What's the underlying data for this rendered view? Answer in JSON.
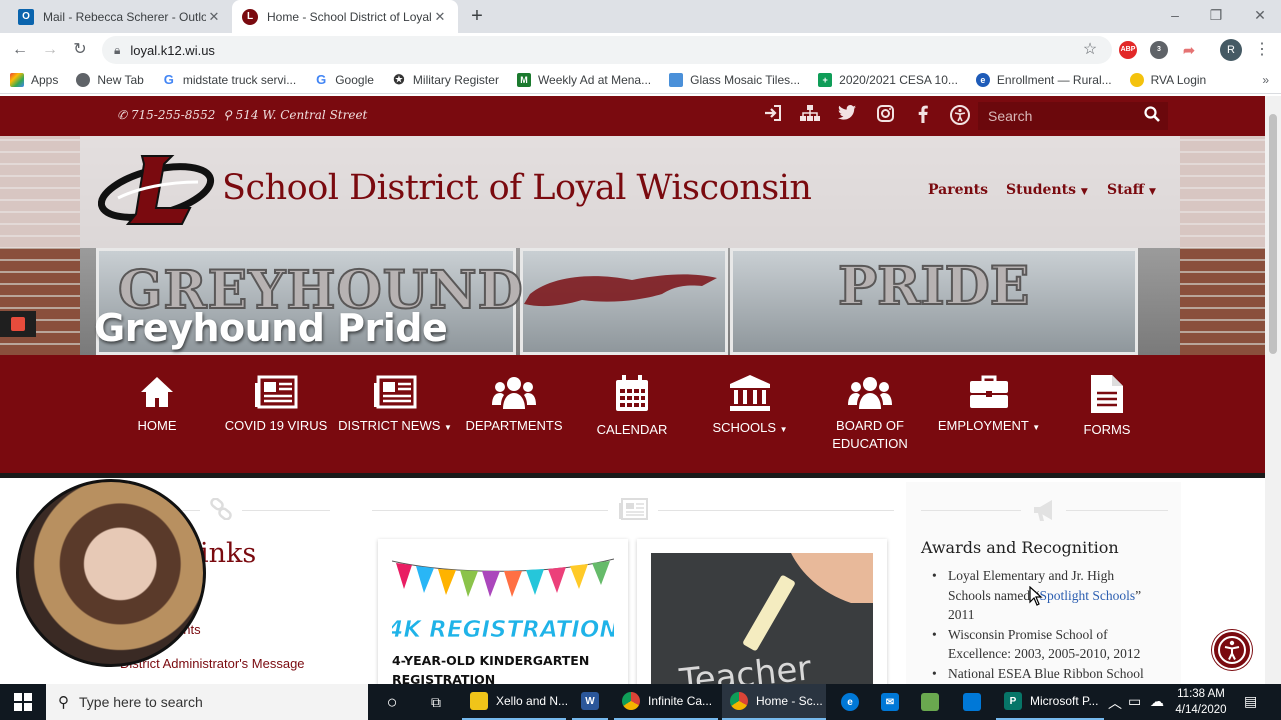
{
  "browser": {
    "tabs": [
      {
        "title": "Mail - Rebecca Scherer - Outlook",
        "active": false
      },
      {
        "title": "Home - School District of Loyal W",
        "active": true
      }
    ],
    "url": "loyal.k12.wi.us",
    "profile_initial": "R",
    "extensions": [
      "ABP",
      "3"
    ],
    "bookmarks": [
      {
        "label": "Apps",
        "icon": "apps-grid-icon",
        "color": "#ea4335"
      },
      {
        "label": "New Tab",
        "icon": "globe-icon",
        "color": "#5f6368"
      },
      {
        "label": "midstate truck servi...",
        "icon": "google-icon",
        "color": "#4285f4"
      },
      {
        "label": "Google",
        "icon": "google-icon",
        "color": "#4285f4"
      },
      {
        "label": "Military Register",
        "icon": "star-badge-icon",
        "color": "#333333"
      },
      {
        "label": "Weekly Ad at Mena...",
        "icon": "m-icon",
        "color": "#1b7a2e"
      },
      {
        "label": "Glass Mosaic Tiles...",
        "icon": "tile-icon",
        "color": "#4a90d9"
      },
      {
        "label": "2020/2021 CESA 10...",
        "icon": "plus-sheet-icon",
        "color": "#0f9d58"
      },
      {
        "label": "Enrollment — Rural...",
        "icon": "circle-e-icon",
        "color": "#1e5bb8"
      },
      {
        "label": "RVA Login",
        "icon": "bulb-icon",
        "color": "#f4c20d"
      }
    ]
  },
  "site": {
    "phone": "715-255-8552",
    "address": "514 W. Central Street",
    "search_placeholder": "Search",
    "title": "School District of Loyal Wisconsin",
    "header_nav": [
      "Parents",
      "Students",
      "Staff"
    ],
    "hero_painted_left": "GREYHOUND",
    "hero_painted_right": "PRIDE",
    "hero_caption": "Greyhound Pride",
    "main_nav": [
      {
        "label": "HOME",
        "icon": "home-icon",
        "dropdown": false
      },
      {
        "label": "COVID 19 VIRUS",
        "icon": "newspaper-icon",
        "dropdown": false
      },
      {
        "label": "DISTRICT NEWS",
        "icon": "newspaper-icon",
        "dropdown": true
      },
      {
        "label": "DEPARTMENTS",
        "icon": "users-icon",
        "dropdown": false
      },
      {
        "label": "CALENDAR",
        "icon": "calendar-icon",
        "dropdown": false
      },
      {
        "label": "SCHOOLS",
        "icon": "institution-icon",
        "dropdown": true
      },
      {
        "label": "BOARD OF EDUCATION",
        "icon": "users-icon",
        "dropdown": false
      },
      {
        "label": "EMPLOYMENT",
        "icon": "briefcase-icon",
        "dropdown": true
      },
      {
        "label": "FORMS",
        "icon": "file-icon",
        "dropdown": false
      }
    ],
    "quicklinks_title_visible": "inks",
    "quicklinks": [
      "ents",
      "District Administrator's Message"
    ],
    "cards": [
      {
        "title": "4-YEAR-OLD KINDERGARTEN REGISTRATION",
        "image_text": "4K REGISTRATION"
      },
      {
        "title": "",
        "image_text": "Teacher"
      }
    ],
    "awards_title": "Awards and Recognition",
    "awards": [
      {
        "before": "Loyal Elementary and Jr. High Schools named “",
        "link": "Spotlight Schools",
        "after": "” 2011"
      },
      {
        "before": "Wisconsin Promise School of Excellence: 2003, 2005-2010, 2012",
        "link": "",
        "after": ""
      },
      {
        "before": "National ESEA Blue Ribbon School Award",
        "link": "",
        "after": ""
      }
    ],
    "brand_color": "#7a0a0f"
  },
  "taskbar": {
    "search_placeholder": "Type here to search",
    "apps": [
      {
        "label": "Xello and N...",
        "icon": "folder-icon",
        "color": "#f0c419"
      },
      {
        "label": "",
        "icon": "word-icon",
        "color": "#2b579a"
      },
      {
        "label": "Infinite Ca...",
        "icon": "chrome-icon",
        "color": "#db4437"
      },
      {
        "label": "Home - Sc...",
        "icon": "chrome-icon",
        "color": "#db4437"
      },
      {
        "label": "",
        "icon": "edge-icon",
        "color": "#0078d7"
      },
      {
        "label": "",
        "icon": "mail-icon",
        "color": "#0078d7"
      },
      {
        "label": "",
        "icon": "store-icon",
        "color": "#0078d7"
      },
      {
        "label": "",
        "icon": "computer-icon",
        "color": "#6aa84f"
      },
      {
        "label": "Microsoft P...",
        "icon": "publisher-icon",
        "color": "#077568"
      }
    ],
    "time": "11:38 AM",
    "date": "4/14/2020"
  }
}
